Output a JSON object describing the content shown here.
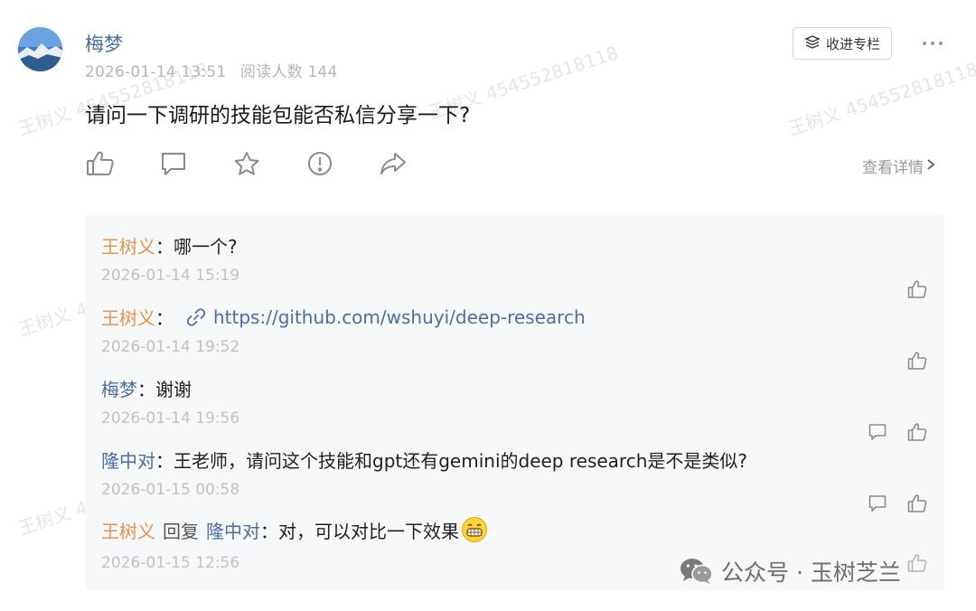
{
  "post": {
    "author": "梅梦",
    "date": "2026-01-14 13:51",
    "read_count": "阅读人数 144",
    "text": "请问一下调研的技能包能否私信分享一下?",
    "collect_label": "收进专栏",
    "detail_label": "查看详情"
  },
  "watermark": "王树义 454552818118",
  "comments": [
    {
      "name": "王树义",
      "sep": "：",
      "text": "哪一个?",
      "time": "2026-01-14 15:19"
    },
    {
      "name": "王树义",
      "sep": "：",
      "link": "https://github.com/wshuyi/deep-research",
      "time": "2026-01-14 19:52"
    },
    {
      "name": "梅梦",
      "sep": "：",
      "text": "谢谢",
      "time": "2026-01-14 19:56"
    },
    {
      "name": "隆中对",
      "sep": "：",
      "text": "王老师，请问这个技能和gpt还有gemini的deep research是不是类似?",
      "time": "2026-01-15 00:58"
    },
    {
      "name": "王树义",
      "reply_word": "回复",
      "reply_to": "隆中对",
      "sep": "：",
      "text": "对，可以对比一下效果",
      "time": "2026-01-15 12:56"
    }
  ],
  "footer": {
    "brand": "公众号 · 玉树芝兰"
  },
  "colors": {
    "name_blue": "#4a6da3",
    "name_orange": "#e6944a",
    "panel_bg": "#f7f8fa"
  }
}
